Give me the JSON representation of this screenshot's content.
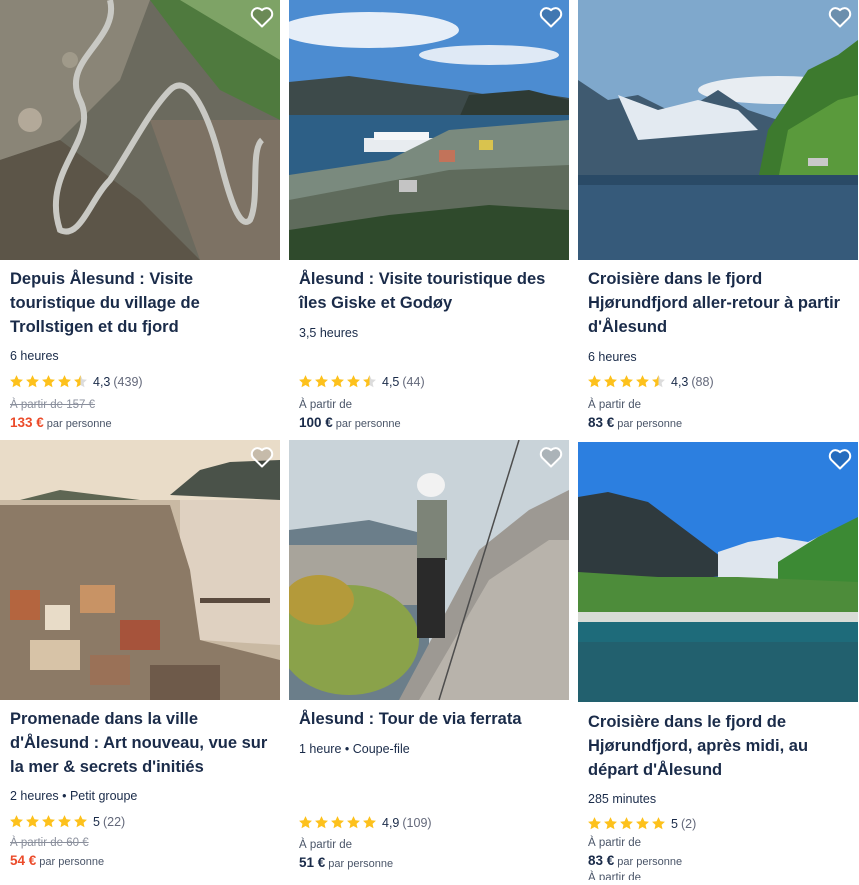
{
  "cards": [
    {
      "title": "Depuis Ålesund : Visite touristique du village de Trollstigen et du fjord",
      "duration": "6 heures",
      "rating": "4,3",
      "reviews": "(439)",
      "stars": 4.5,
      "from_label": "À partir de 157 €",
      "price": "133 €",
      "per": "par personne",
      "sale": true,
      "heart_icon": "heart-outline-icon"
    },
    {
      "title": "Ålesund : Visite touristique des îles Giske et Godøy",
      "duration": "3,5 heures",
      "rating": "4,5",
      "reviews": "(44)",
      "stars": 4.5,
      "from_label": "À partir de",
      "price": "100 €",
      "per": "par personne",
      "sale": false
    },
    {
      "title": "Croisière dans le fjord Hjørundfjord aller-retour à partir d'Ålesund",
      "duration": "6 heures",
      "rating": "4,3",
      "reviews": "(88)",
      "stars": 4.5,
      "from_label": "À partir de",
      "price": "83 €",
      "per": "par personne",
      "sale": false
    },
    {
      "title": "Promenade dans la ville d'Ålesund : Art nouveau, vue sur la mer & secrets d'initiés",
      "duration": "2 heures • Petit groupe",
      "rating": "5",
      "reviews": "(22)",
      "stars": 5,
      "from_label": "À partir de 60 €",
      "price": "54 €",
      "per": "par personne",
      "sale": true
    },
    {
      "title": "Ålesund : Tour de via ferrata",
      "duration": "1 heure • Coupe-file",
      "rating": "4,9",
      "reviews": "(109)",
      "stars": 5,
      "from_label": "À partir de",
      "price": "51 €",
      "per": "par personne",
      "sale": false
    },
    {
      "title": "Croisière dans le fjord de Hjørundfjord, après midi, au départ d'Ålesund",
      "duration": "285 minutes",
      "rating": "5",
      "reviews": "(2)",
      "stars": 5,
      "from_label": "À partir de",
      "price": "83 €",
      "per": "par personne",
      "from_label_2": "À partir de",
      "sale": false
    }
  ],
  "colors": {
    "text": "#1a2b49",
    "sale": "#eb4b2a",
    "star": "#fdc11c"
  }
}
